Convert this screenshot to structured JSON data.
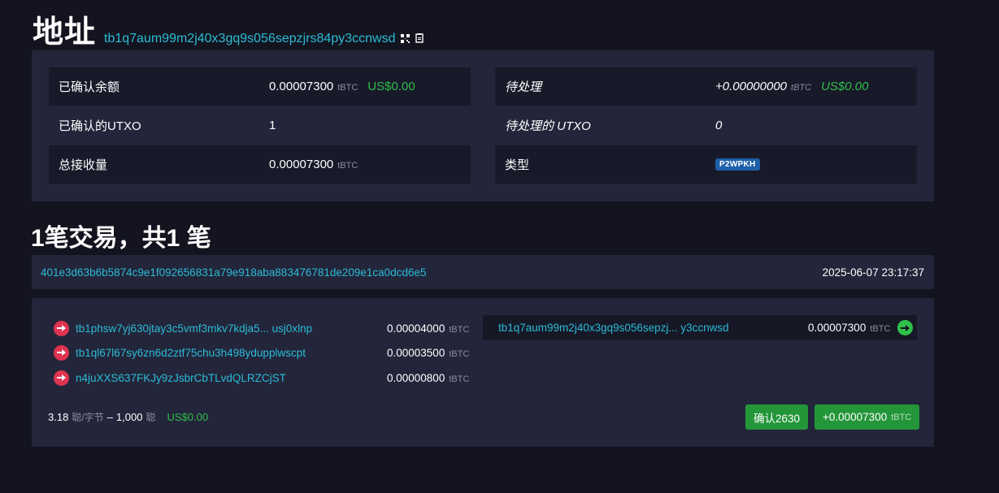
{
  "header": {
    "title": "地址",
    "address": "tb1q7aum99m2j40x3gq9s056sepzjrs84py3ccnwsd",
    "icons": [
      "qr-code-icon",
      "copy-icon"
    ]
  },
  "summary": {
    "confirmed_balance": {
      "label": "已确认余额",
      "value": "0.00007300",
      "unit": "tBTC",
      "usd": "US$0.00"
    },
    "confirmed_utxo": {
      "label": "已确认的UTXO",
      "value": "1"
    },
    "total_received": {
      "label": "总接收量",
      "value": "0.00007300",
      "unit": "tBTC"
    },
    "pending": {
      "label": "待处理",
      "value": "+0.00000000",
      "unit": "tBTC",
      "usd": "US$0.00"
    },
    "pending_utxo": {
      "label": "待处理的 UTXO",
      "value": "0"
    },
    "type": {
      "label": "类型",
      "value": "P2WPKH"
    }
  },
  "transactions": {
    "title": "1笔交易，共1 笔",
    "items": [
      {
        "txid": "401e3d63b6b5874c9e1f092656831a79e918aba883476781de209e1ca0dcd6e5",
        "time": "2025-06-07 23:17:37",
        "inputs": [
          {
            "address": "tb1phsw7yj630jtay3c5vmf3mkv7kdja5...  usj0xlnp",
            "amount": "0.00004000",
            "unit": "tBTC"
          },
          {
            "address": "tb1ql67l67sy6zn6d2ztf75chu3h498ydupplwscpt",
            "amount": "0.00003500",
            "unit": "tBTC"
          },
          {
            "address": "n4juXXS637FKJy9zJsbrCbTLvdQLRZCjST",
            "amount": "0.00000800",
            "unit": "tBTC"
          }
        ],
        "outputs": [
          {
            "address": "tb1q7aum99m2j40x3gq9s056sepzj... y3ccnwsd",
            "amount": "0.00007300",
            "unit": "tBTC"
          }
        ],
        "fee_rate": "3.18",
        "fee_rate_unit": "聪/字节",
        "fee_sep": "–",
        "fee": "1,000",
        "fee_unit": "聪",
        "fee_usd": "US$0.00",
        "confirmations_label": "确认2630",
        "net_amount": "+0.00007300",
        "net_unit": "tBTC"
      }
    ]
  },
  "colors": {
    "link": "#2bbbd6",
    "usd": "#2fbf4a",
    "input_arrow": "#e0334f",
    "output_arrow": "#2fbf4a",
    "button": "#23963a",
    "badge": "#1d5fa8"
  }
}
